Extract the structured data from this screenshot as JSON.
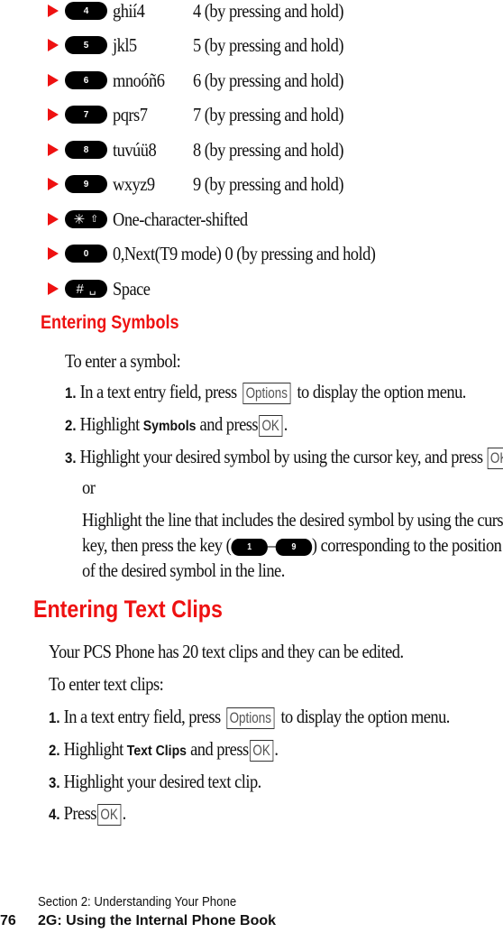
{
  "key_list": [
    {
      "key": "4",
      "letters": "ghií4",
      "desc": "4 (by pressing and hold)"
    },
    {
      "key": "5",
      "letters": "jkl5",
      "desc": "5 (by pressing and hold)"
    },
    {
      "key": "6",
      "letters": "mnoóñ6",
      "desc": "6 (by pressing and hold)"
    },
    {
      "key": "7",
      "letters": "pqrs7",
      "desc": "7 (by pressing and hold)"
    },
    {
      "key": "8",
      "letters": "tuvúü8",
      "desc": "8 (by pressing and hold)"
    },
    {
      "key": "9",
      "letters": "wxyz9",
      "desc": "9 (by pressing and hold)"
    },
    {
      "key": "✳⇧",
      "letters": "One-character-shifted"
    },
    {
      "key": "0",
      "letters": "0,Next(T9 mode) 0 (by pressing and hold)"
    },
    {
      "key": "#␣",
      "letters": "Space"
    }
  ],
  "symbols": {
    "heading": "Entering Symbols",
    "intro": "To enter a symbol:",
    "step1": {
      "num": "1.",
      "pre": "In a text entry field, press",
      "softkey": "Options",
      "post": "to display the option menu."
    },
    "step2": {
      "num": "2.",
      "pre": "Highlight",
      "bold": "Symbols",
      "mid": "and press",
      "softkey": "OK",
      "post": "."
    },
    "step3": {
      "num": "3.",
      "pre": "Highlight your desired symbol by using the cursor key, and press",
      "softkey": "OK",
      "post": "."
    },
    "or": "or",
    "alt_line1": "Highlight the line that includes the desired symbol by using the cursor",
    "alt_line2_pre": "key, then press the key (",
    "alt_key_from": "1",
    "alt_dash": "–",
    "alt_key_to": "9",
    "alt_line2_post": ") corresponding to the position",
    "alt_line3": "of the desired symbol in the line."
  },
  "text_clips": {
    "heading": "Entering Text Clips",
    "intro1": "Your PCS Phone has 20 text clips and they can be edited.",
    "intro2": "To enter text clips:",
    "step1": {
      "num": "1.",
      "pre": "In a text entry field, press",
      "softkey": "Options",
      "post": "to display the option menu."
    },
    "step2": {
      "num": "2.",
      "pre": "Highlight",
      "bold": "Text Clips",
      "mid": "and press",
      "softkey": "OK",
      "post": "."
    },
    "step3": {
      "num": "3.",
      "text": "Highlight your desired text clip."
    },
    "step4": {
      "num": "4.",
      "pre": "Press",
      "softkey": "OK",
      "post": "."
    }
  },
  "footer": {
    "section": "Section 2: Understanding Your Phone",
    "page_number": "76",
    "chapter": "2G: Using the Internal Phone Book"
  }
}
